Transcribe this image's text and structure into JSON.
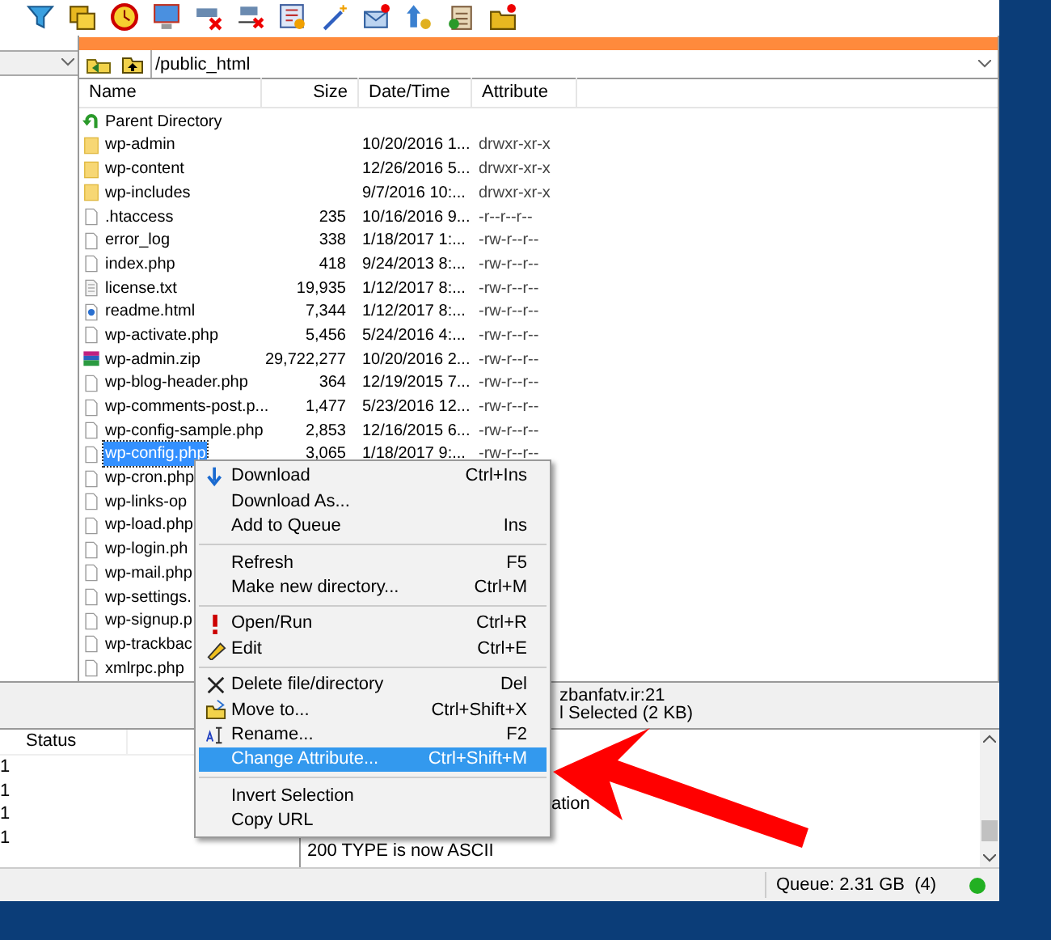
{
  "remote_panel": {
    "path": "/public_html",
    "columns": [
      "Name",
      "Size",
      "Date/Time",
      "Attribute"
    ],
    "files": [
      {
        "kind": "parent",
        "name": "Parent Directory",
        "selected": false
      },
      {
        "kind": "folder",
        "name": "wp-admin",
        "date": "10/20/2016 1...",
        "attribute": "drwxr-xr-x",
        "selected": false
      },
      {
        "kind": "folder",
        "name": "wp-content",
        "date": "12/26/2016 5...",
        "attribute": "drwxr-xr-x",
        "selected": false
      },
      {
        "kind": "folder",
        "name": "wp-includes",
        "date": "9/7/2016 10:...",
        "attribute": "drwxr-xr-x",
        "selected": false
      },
      {
        "kind": "file",
        "name": ".htaccess",
        "size": "235",
        "date": "10/16/2016 9...",
        "attribute": "-r--r--r--",
        "selected": false
      },
      {
        "kind": "file",
        "name": "error_log",
        "size": "338",
        "date": "1/18/2017 1:...",
        "attribute": "-rw-r--r--",
        "selected": false
      },
      {
        "kind": "file",
        "name": "index.php",
        "size": "418",
        "date": "9/24/2013 8:...",
        "attribute": "-rw-r--r--",
        "selected": false
      },
      {
        "kind": "text",
        "name": "license.txt",
        "size": "19,935",
        "date": "1/12/2017 8:...",
        "attribute": "-rw-r--r--",
        "selected": false
      },
      {
        "kind": "html",
        "name": "readme.html",
        "size": "7,344",
        "date": "1/12/2017 8:...",
        "attribute": "-rw-r--r--",
        "selected": false
      },
      {
        "kind": "file",
        "name": "wp-activate.php",
        "size": "5,456",
        "date": "5/24/2016 4:...",
        "attribute": "-rw-r--r--",
        "selected": false
      },
      {
        "kind": "zip",
        "name": "wp-admin.zip",
        "size": "29,722,277",
        "date": "10/20/2016 2...",
        "attribute": "-rw-r--r--",
        "selected": false
      },
      {
        "kind": "file",
        "name": "wp-blog-header.php",
        "size": "364",
        "date": "12/19/2015 7...",
        "attribute": "-rw-r--r--",
        "selected": false
      },
      {
        "kind": "file",
        "name": "wp-comments-post.p...",
        "size": "1,477",
        "date": "5/23/2016 12...",
        "attribute": "-rw-r--r--",
        "selected": false
      },
      {
        "kind": "file",
        "name": "wp-config-sample.php",
        "size": "2,853",
        "date": "12/16/2015 6...",
        "attribute": "-rw-r--r--",
        "selected": false
      },
      {
        "kind": "file",
        "name": "wp-config.php",
        "size": "3,065",
        "date": "1/18/2017 9:...",
        "attribute": "-rw-r--r--",
        "selected": true
      },
      {
        "kind": "file",
        "name": "wp-cron.php",
        "selected": false
      },
      {
        "kind": "file",
        "name": "wp-links-op",
        "selected": false
      },
      {
        "kind": "file",
        "name": "wp-load.php",
        "selected": false
      },
      {
        "kind": "file",
        "name": "wp-login.ph",
        "selected": false
      },
      {
        "kind": "file",
        "name": "wp-mail.php",
        "selected": false
      },
      {
        "kind": "file",
        "name": "wp-settings.",
        "selected": false
      },
      {
        "kind": "file",
        "name": "wp-signup.p",
        "selected": false
      },
      {
        "kind": "file",
        "name": "wp-trackbac",
        "selected": false
      },
      {
        "kind": "file",
        "name": "xmlrpc.php",
        "selected": false
      }
    ]
  },
  "panel_status": [
    "zbanfatv.ir:21",
    "l Selected (2 KB)"
  ],
  "queue_list": {
    "columns": [
      "Status"
    ],
    "rows": [
      "1",
      "1",
      "1",
      "1"
    ]
  },
  "log": [
    "ation",
    "200 TYPE is now ASCII"
  ],
  "status_bar": {
    "queue": "Queue: 2.31 GB  (4)"
  },
  "context_menu": [
    {
      "kind": "item",
      "label": "Download",
      "shortcut": "Ctrl+Ins",
      "selected": false
    },
    {
      "kind": "item",
      "label": "Download As...",
      "selected": false
    },
    {
      "kind": "item",
      "label": "Add to Queue",
      "shortcut": "Ins",
      "selected": false
    },
    {
      "kind": "separator"
    },
    {
      "kind": "item",
      "label": "Refresh",
      "shortcut": "F5",
      "selected": false
    },
    {
      "kind": "item",
      "label": "Make new directory...",
      "shortcut": "Ctrl+M",
      "selected": false
    },
    {
      "kind": "separator"
    },
    {
      "kind": "item",
      "label": "Open/Run",
      "shortcut": "Ctrl+R",
      "selected": false
    },
    {
      "kind": "item",
      "label": "Edit",
      "shortcut": "Ctrl+E",
      "selected": false
    },
    {
      "kind": "separator"
    },
    {
      "kind": "item",
      "label": "Delete file/directory",
      "shortcut": "Del",
      "selected": false
    },
    {
      "kind": "item",
      "label": "Move to...",
      "shortcut": "Ctrl+Shift+X",
      "selected": false
    },
    {
      "kind": "item",
      "label": "Rename...",
      "shortcut": "F2",
      "selected": false
    },
    {
      "kind": "item",
      "label": "Change Attribute...",
      "shortcut": "Ctrl+Shift+M",
      "selected": true
    },
    {
      "kind": "separator"
    },
    {
      "kind": "item",
      "label": "Invert Selection",
      "selected": false
    },
    {
      "kind": "item",
      "label": "Copy URL",
      "selected": false
    }
  ]
}
